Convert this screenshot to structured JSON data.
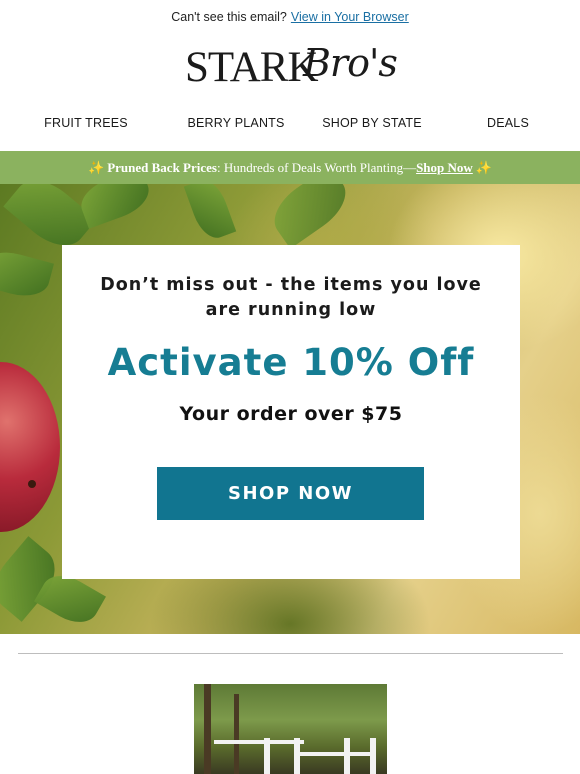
{
  "topbar": {
    "text": "Can't see this email?",
    "link": "View in Your Browser"
  },
  "logo": {
    "stark": "STARK",
    "bros": "Bro's"
  },
  "nav": {
    "items": [
      "FRUIT TREES",
      "BERRY PLANTS",
      "SHOP BY STATE",
      "DEALS"
    ]
  },
  "promo": {
    "sparkle": "✨",
    "bold": "Pruned Back Prices",
    "text": ": Hundreds of Deals Worth Planting—",
    "link": "Shop Now"
  },
  "hero": {
    "intro_line1": "Don’t miss out - the items you love",
    "intro_line2": "are running low",
    "headline": "Activate 10% Off",
    "subline": "Your order over $75",
    "button": "SHOP NOW"
  },
  "colors": {
    "accent": "#167d93",
    "button": "#117590",
    "promo_bar": "#8bb25f",
    "link": "#1a6fa3"
  }
}
